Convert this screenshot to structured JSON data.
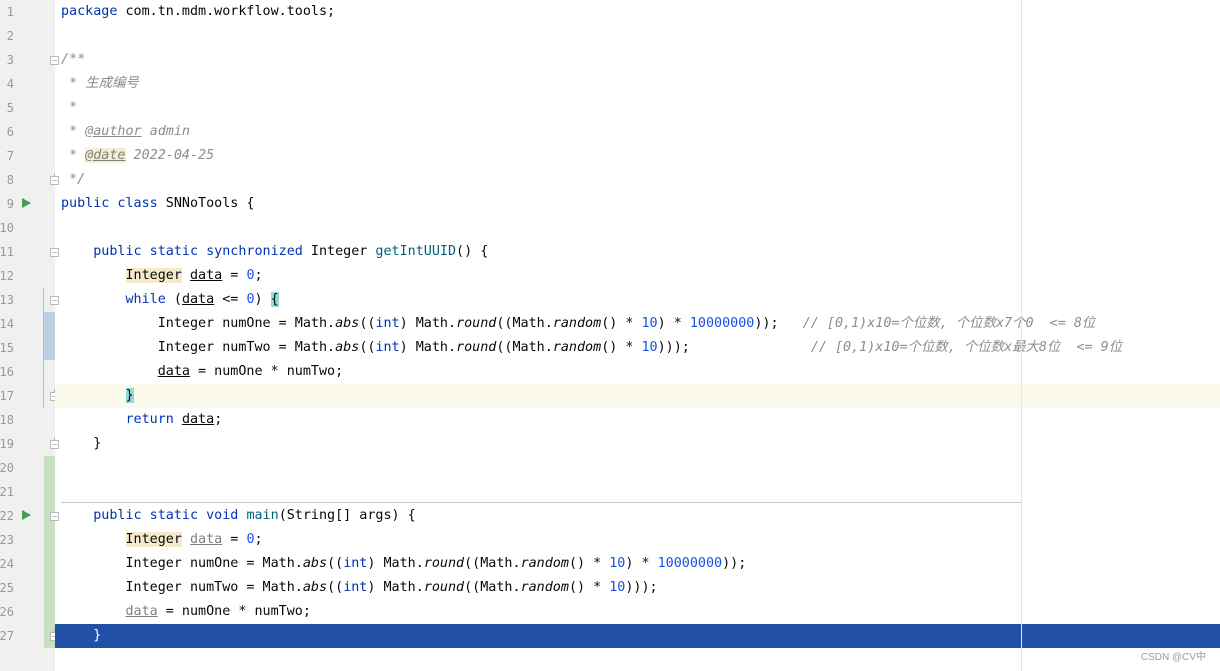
{
  "editor": {
    "lines": [
      {
        "n": "1"
      },
      {
        "n": "2"
      },
      {
        "n": "3"
      },
      {
        "n": "4"
      },
      {
        "n": "5"
      },
      {
        "n": "6"
      },
      {
        "n": "7"
      },
      {
        "n": "8"
      },
      {
        "n": "9"
      },
      {
        "n": "10"
      },
      {
        "n": "11"
      },
      {
        "n": "12"
      },
      {
        "n": "13"
      },
      {
        "n": "14"
      },
      {
        "n": "15"
      },
      {
        "n": "16"
      },
      {
        "n": "17"
      },
      {
        "n": "18"
      },
      {
        "n": "19"
      },
      {
        "n": "20"
      },
      {
        "n": "21"
      },
      {
        "n": "22"
      },
      {
        "n": "23"
      },
      {
        "n": "24"
      },
      {
        "n": "25"
      },
      {
        "n": "26"
      },
      {
        "n": "27"
      }
    ],
    "code": {
      "l1_kw": "package",
      "l1_rest": " com.tn.mdm.workflow.tools;",
      "l3": "/**",
      "l4": " * 生成编号",
      "l5": " *",
      "l6_pre": " * ",
      "l6_tag": "@author",
      "l6_val": " admin",
      "l7_pre": " * ",
      "l7_tag": "@date",
      "l7_val": " 2022-04-25",
      "l8": " */",
      "l9_kw": "public class",
      "l9_rest": " SNNoTools {",
      "l11_indent": "    ",
      "l11_kw": "public static synchronized",
      "l11_type": " Integer ",
      "l11_fn": "getIntUUID",
      "l11_rest": "() {",
      "l12_indent": "        ",
      "l12_type": "Integer",
      "l12_sp": " ",
      "l12_var": "data",
      "l12_eq": " = ",
      "l12_num": "0",
      "l12_end": ";",
      "l13_indent": "        ",
      "l13_kw": "while",
      "l13_a": " (",
      "l13_var": "data",
      "l13_b": " <= ",
      "l13_num": "0",
      "l13_c": ") ",
      "l13_brace": "{",
      "l14_indent": "            ",
      "l14_a": "Integer numOne = Math.",
      "l14_abs": "abs",
      "l14_b": "((",
      "l14_int": "int",
      "l14_c": ") Math.",
      "l14_round": "round",
      "l14_d": "((Math.",
      "l14_random": "random",
      "l14_e": "() * ",
      "l14_n1": "10",
      "l14_f": ") * ",
      "l14_n2": "10000000",
      "l14_g": "));   ",
      "l14_cm": "// [0,1)x10=个位数, 个位数x7个0  <= 8位",
      "l15_indent": "            ",
      "l15_a": "Integer numTwo = Math.",
      "l15_abs": "abs",
      "l15_b": "((",
      "l15_int": "int",
      "l15_c": ") Math.",
      "l15_round": "round",
      "l15_d": "((Math.",
      "l15_random": "random",
      "l15_e": "() * ",
      "l15_n1": "10",
      "l15_f": ")));               ",
      "l15_cm": "// [0,1)x10=个位数, 个位数x最大8位  <= 9位",
      "l16_indent": "            ",
      "l16_var": "data",
      "l16_rest": " = numOne * numTwo;",
      "l17_indent": "        ",
      "l17_brace": "}",
      "l18_indent": "        ",
      "l18_kw": "return",
      "l18_sp": " ",
      "l18_var": "data",
      "l18_end": ";",
      "l19": "    }",
      "l22_indent": "    ",
      "l22_kw": "public static void",
      "l22_sp": " ",
      "l22_fn": "main",
      "l22_rest": "(String[] args) {",
      "l23_indent": "        ",
      "l23_type": "Integer",
      "l23_sp": " ",
      "l23_var": "data",
      "l23_eq": " = ",
      "l23_num": "0",
      "l23_end": ";",
      "l24_indent": "        ",
      "l24_a": "Integer numOne = Math.",
      "l24_abs": "abs",
      "l24_b": "((",
      "l24_int": "int",
      "l24_c": ") Math.",
      "l24_round": "round",
      "l24_d": "((Math.",
      "l24_random": "random",
      "l24_e": "() * ",
      "l24_n1": "10",
      "l24_f": ") * ",
      "l24_n2": "10000000",
      "l24_g": "));",
      "l25_indent": "        ",
      "l25_a": "Integer numTwo = Math.",
      "l25_abs": "abs",
      "l25_b": "((",
      "l25_int": "int",
      "l25_c": ") Math.",
      "l25_round": "round",
      "l25_d": "((Math.",
      "l25_random": "random",
      "l25_e": "() * ",
      "l25_n1": "10",
      "l25_f": ")));",
      "l26_indent": "        ",
      "l26_var": "data",
      "l26_rest": " = numOne * numTwo;",
      "l27": "    }"
    }
  },
  "watermark": "CSDN @CV中",
  "colors": {
    "keyword": "#0033b3",
    "method": "#00627a",
    "number": "#1750eb",
    "comment": "#8c8c8c",
    "selection": "#2150a6",
    "current_line": "#fcfaed",
    "gutter": "#f0f0f0",
    "vcs_added": "#c9dfc1",
    "vcs_modified": "#bccfe2"
  },
  "icons": [
    "run-gutter-icon",
    "fold-icon"
  ]
}
